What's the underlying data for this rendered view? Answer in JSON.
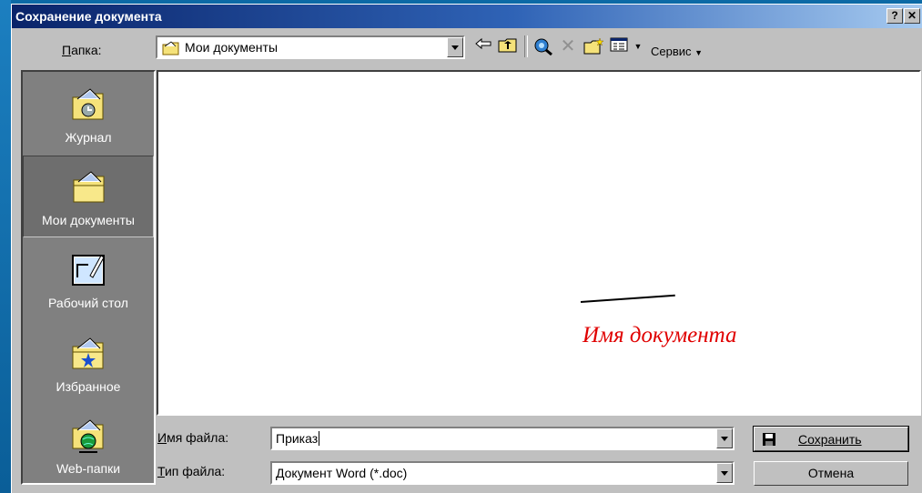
{
  "window": {
    "title": "Сохранение документа",
    "help_label": "?",
    "close_label": "✕"
  },
  "toolbar": {
    "folder_label_prefix": "П",
    "folder_label_rest": "апка:",
    "folder_value": "Мои документы",
    "service_label": "Сервис"
  },
  "places": [
    {
      "label": "Журнал",
      "icon": "history-folder-icon",
      "selected": false
    },
    {
      "label": "Мои документы",
      "icon": "my-documents-folder-icon",
      "selected": true
    },
    {
      "label": "Рабочий стол",
      "icon": "desktop-icon",
      "selected": false
    },
    {
      "label": "Избранное",
      "icon": "favorites-folder-icon",
      "selected": false
    },
    {
      "label": "Web-папки",
      "icon": "web-folders-icon",
      "selected": false
    }
  ],
  "annotation": {
    "text": "Имя документа",
    "color": "#e00000"
  },
  "filename": {
    "label_prefix": "И",
    "label_rest": "мя файла:",
    "value": "Приказ"
  },
  "filetype": {
    "label_prefix": "Т",
    "label_rest": "ип файла:",
    "value": "Документ Word (*.doc)"
  },
  "buttons": {
    "save_prefix": "С",
    "save_rest": "охранить",
    "cancel": "Отмена"
  }
}
